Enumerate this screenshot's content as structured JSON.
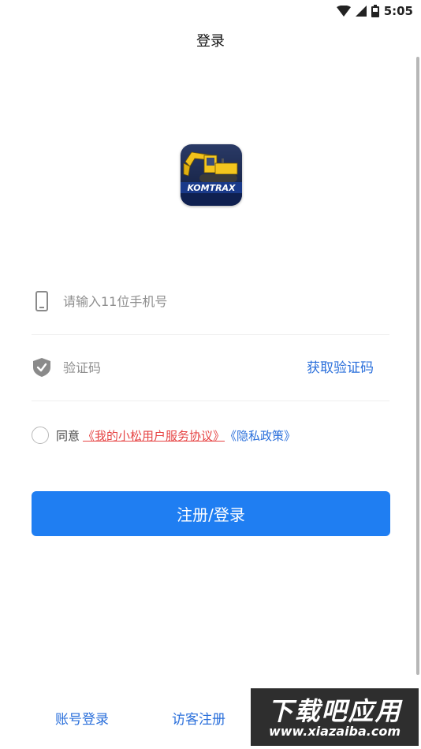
{
  "status_bar": {
    "time": "5:05"
  },
  "header": {
    "title": "登录"
  },
  "logo": {
    "text": "KOMTRAX"
  },
  "phone_field": {
    "placeholder": "请输入11位手机号",
    "value": ""
  },
  "code_field": {
    "placeholder": "验证码",
    "value": "",
    "get_code_label": "获取验证码"
  },
  "agreement": {
    "prefix": "同意",
    "user_agreement": "《我的小松用户服务协议》",
    "privacy_policy": "《隐私政策》",
    "checked": false
  },
  "submit": {
    "label": "注册/登录"
  },
  "footer": {
    "account_login": "账号登录",
    "guest_register": "访客注册"
  },
  "watermark": {
    "title": "下载吧应用",
    "url": "www.xiazaiba.com"
  },
  "colors": {
    "primary": "#1f7ef2",
    "link_blue": "#2a6fdb",
    "link_red": "#e64444"
  }
}
